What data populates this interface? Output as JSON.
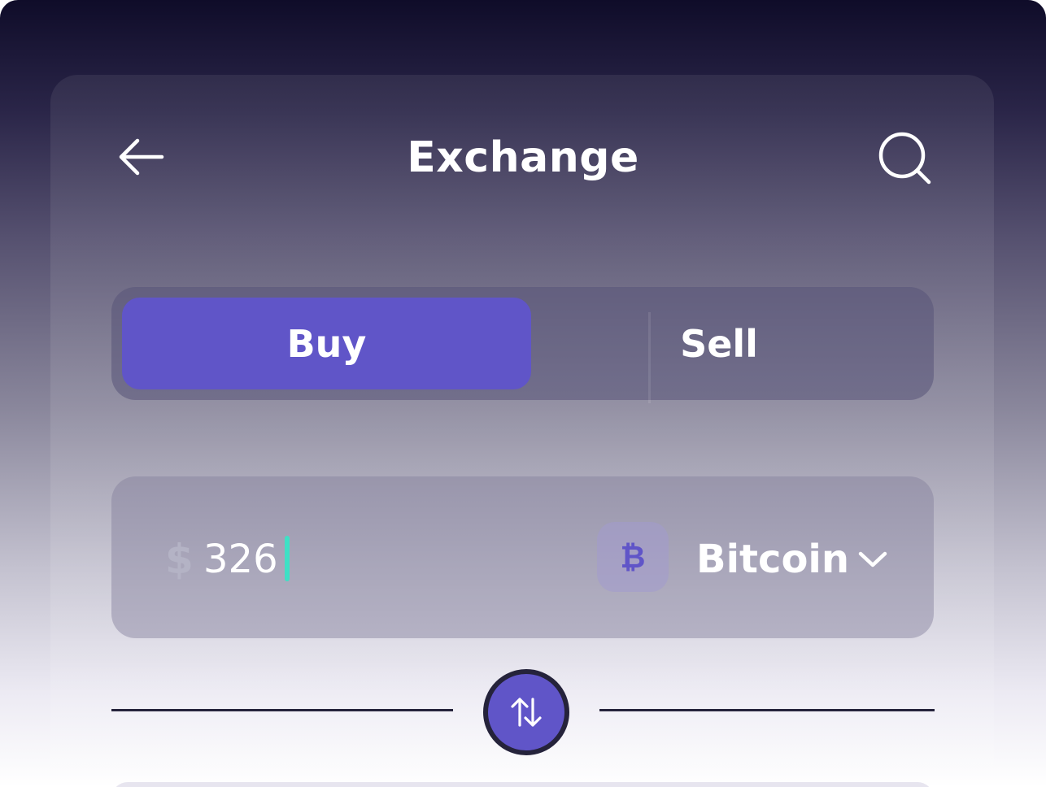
{
  "header": {
    "title": "Exchange",
    "back_icon": "arrow-left-icon",
    "search_icon": "search-icon"
  },
  "trade_toggle": {
    "options": [
      {
        "label": "Buy",
        "selected": true
      },
      {
        "label": "Sell",
        "selected": false
      }
    ]
  },
  "amount_input": {
    "currency_symbol": "$",
    "value": "326",
    "coin_icon": "bitcoin-icon",
    "coin_glyph": "₿",
    "coin_name": "Bitcoin",
    "dropdown_icon": "chevron-down-icon"
  },
  "swap": {
    "icon": "swap-arrows-icon"
  },
  "colors": {
    "accent": "#6055c8",
    "caret": "#3fe0c5",
    "dark": "#25233b"
  }
}
